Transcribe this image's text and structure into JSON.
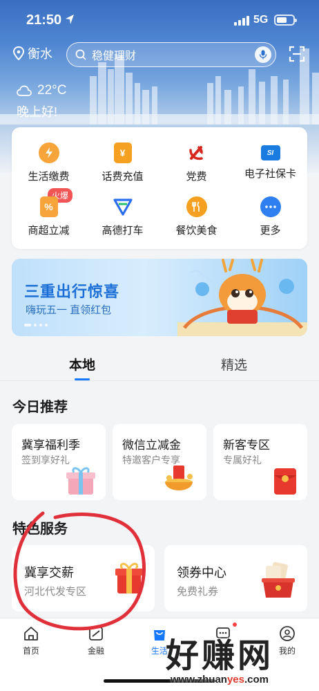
{
  "status_bar": {
    "time": "21:50",
    "network": "5G"
  },
  "header": {
    "location": "衡水",
    "search_placeholder": "稳健理财",
    "temperature": "22°C",
    "greeting": "晚上好!"
  },
  "services": [
    {
      "label": "生活缴费",
      "icon": "bolt-icon",
      "color": "#f59a23"
    },
    {
      "label": "话费充值",
      "icon": "yen-phone-icon",
      "color": "#f5a020"
    },
    {
      "label": "党费",
      "icon": "party-emblem-icon",
      "color": "#d7261e"
    },
    {
      "label": "电子社保卡",
      "icon": "social-security-card-icon",
      "color": "#1a7be0"
    },
    {
      "label": "商超立减",
      "icon": "percent-coupon-icon",
      "color": "#f59a23",
      "badge": "火爆"
    },
    {
      "label": "高德打车",
      "icon": "amap-taxi-icon",
      "color": "#2a6ff0"
    },
    {
      "label": "餐饮美食",
      "icon": "cutlery-icon",
      "color": "#f5a020"
    },
    {
      "label": "更多",
      "icon": "more-icon",
      "color": "#2f7ff0"
    }
  ],
  "banner": {
    "title": "三重出行惊喜",
    "subtitle": "嗨玩五一 直领红包",
    "slide_count": 4,
    "active_slide": 1
  },
  "tabs": [
    {
      "label": "本地",
      "active": true
    },
    {
      "label": "精选",
      "active": false
    }
  ],
  "today_section": {
    "title": "今日推荐",
    "cards": [
      {
        "title": "冀享福利季",
        "subtitle": "签到享好礼",
        "icon": "gift-box-icon"
      },
      {
        "title": "微信立减金",
        "subtitle": "特邀客户专享",
        "icon": "red-envelope-pot-icon"
      },
      {
        "title": "新客专区",
        "subtitle": "专属好礼",
        "icon": "red-packet-icon"
      }
    ]
  },
  "feature_section": {
    "title": "特色服务",
    "cards": [
      {
        "title": "冀享交薪",
        "subtitle": "河北代发专区",
        "icon": "gift-box-icon"
      },
      {
        "title": "领券中心",
        "subtitle": "免费礼券",
        "icon": "coupon-bag-icon"
      }
    ]
  },
  "bottom_nav": [
    {
      "label": "首页",
      "icon": "home-icon",
      "active": false
    },
    {
      "label": "金融",
      "icon": "finance-icon",
      "active": false
    },
    {
      "label": "生活",
      "icon": "shopping-bag-icon",
      "active": true
    },
    {
      "label": "社区",
      "icon": "chat-icon",
      "active": false
    },
    {
      "label": "我的",
      "icon": "user-icon",
      "active": false
    }
  ],
  "watermark": {
    "text": "好赚网",
    "url_prefix": "www.zhuan",
    "url_highlight": "yes",
    "url_suffix": ".com"
  },
  "colors": {
    "accent": "#1677ff",
    "annotation": "#e0303a",
    "hot": "#f25555"
  }
}
